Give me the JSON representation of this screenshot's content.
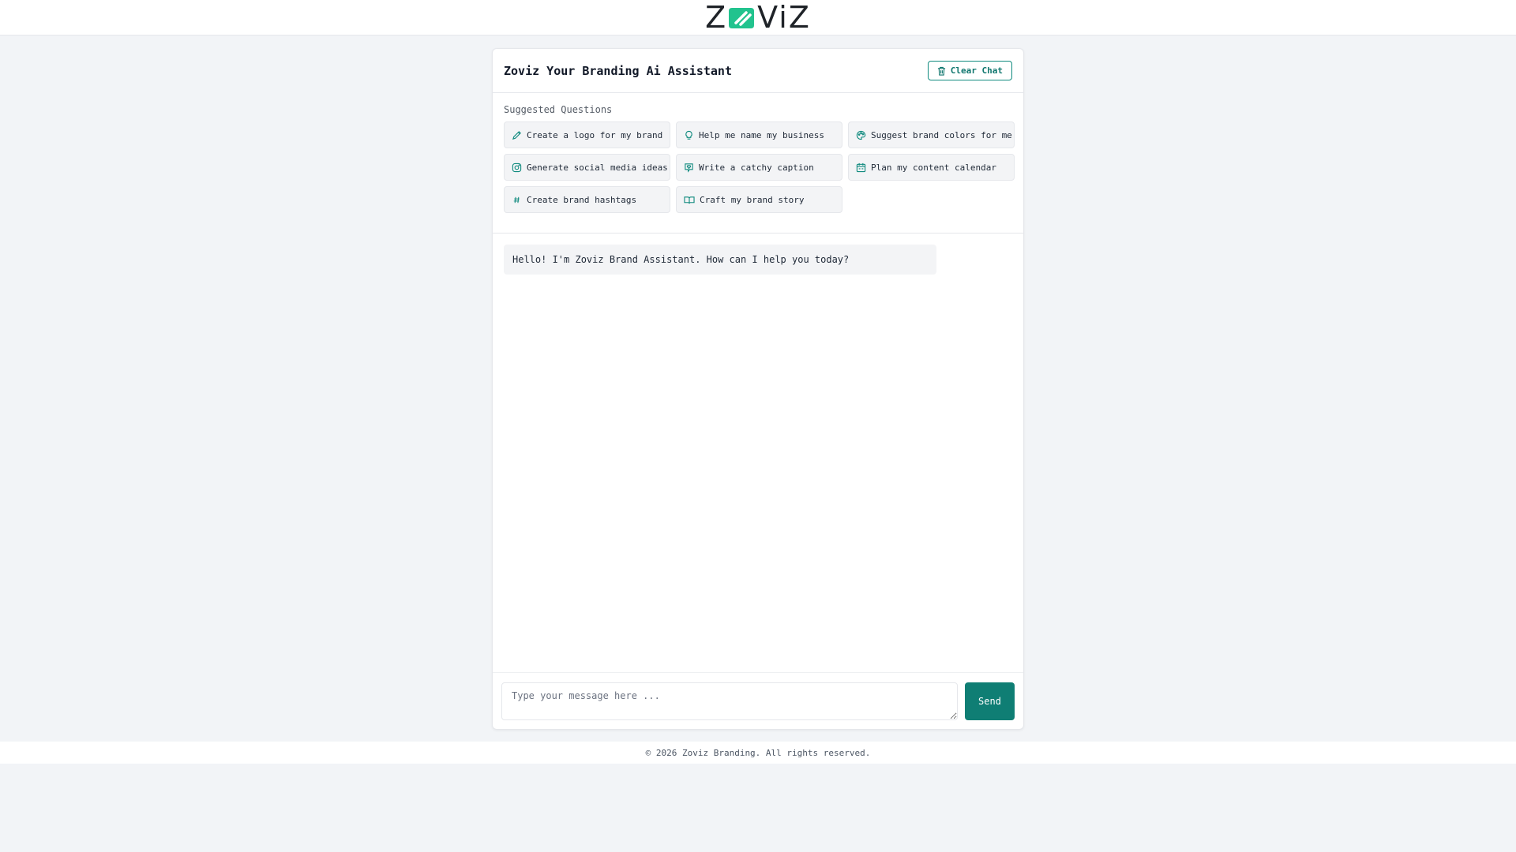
{
  "brand": {
    "logo_left": "Z",
    "logo_right": "ViZ",
    "accent": "#0f8a7e",
    "logo_green": "#22c38e"
  },
  "chat": {
    "title": "Zoviz Your Branding Ai Assistant",
    "clear_label": "Clear Chat",
    "clear_icon": "trash-icon"
  },
  "suggestions": {
    "label": "Suggested Questions",
    "items": [
      {
        "label": "Create a logo for my brand",
        "icon": "pencil-icon"
      },
      {
        "label": "Help me name my business",
        "icon": "lightbulb-icon"
      },
      {
        "label": "Suggest brand colors for me",
        "icon": "palette-icon"
      },
      {
        "label": "Generate social media ideas",
        "icon": "instagram-icon"
      },
      {
        "label": "Write a catchy caption",
        "icon": "message-heart-icon"
      },
      {
        "label": "Plan my content calendar",
        "icon": "calendar-icon"
      },
      {
        "label": "Create brand hashtags",
        "icon": "hashtag-icon"
      },
      {
        "label": "Craft my brand story",
        "icon": "book-icon"
      }
    ]
  },
  "messages": [
    {
      "role": "assistant",
      "text": "Hello! I'm Zoviz Brand Assistant. How can I help you today?"
    }
  ],
  "composer": {
    "placeholder": "Type your message here ...",
    "send_label": "Send"
  },
  "footer": {
    "text": "© 2026 Zoviz Branding. All rights reserved."
  }
}
